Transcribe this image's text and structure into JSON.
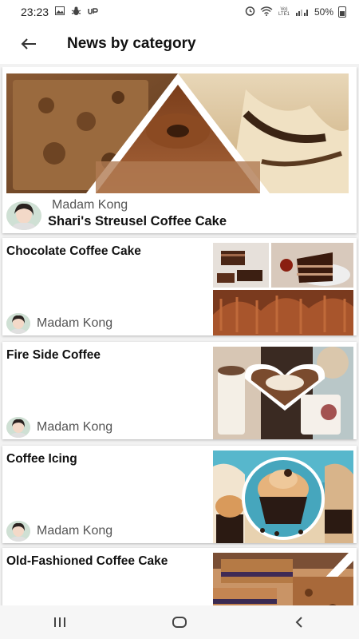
{
  "status_bar": {
    "time": "23:23",
    "battery": "50%",
    "network_label": "Vo) LTE1"
  },
  "header": {
    "title": "News by category"
  },
  "featured": {
    "author": "Madam Kong",
    "title": "Shari's Streusel Coffee Cake"
  },
  "articles": [
    {
      "title": "Chocolate Coffee Cake",
      "author": "Madam Kong"
    },
    {
      "title": "Fire Side Coffee",
      "author": "Madam Kong"
    },
    {
      "title": "Coffee Icing",
      "author": "Madam Kong"
    },
    {
      "title": "Old-Fashioned Coffee Cake",
      "author": "Madam Kong"
    }
  ],
  "colors": {
    "background": "#f2f2f2",
    "card": "#ffffff",
    "text_primary": "#111111",
    "text_secondary": "#555555"
  }
}
